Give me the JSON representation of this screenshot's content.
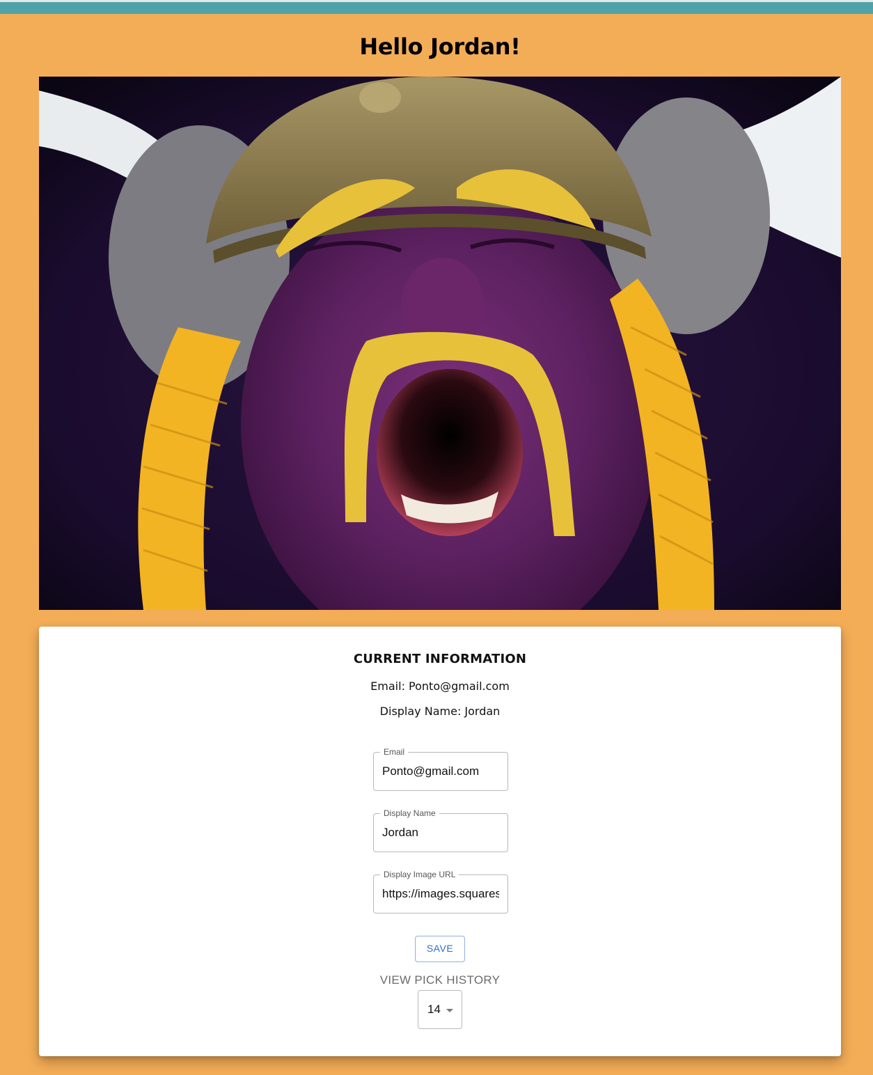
{
  "header": {
    "greeting": "Hello Jordan!"
  },
  "profile_image": {
    "description_icon": "profile-photo",
    "colors": {
      "face_paint_purple": "#5a1f5e",
      "face_paint_gold": "#e8c13a",
      "helmet": "#8c7a4e",
      "braids": "#f2b422"
    }
  },
  "current_info": {
    "title": "CURRENT INFORMATION",
    "email_line": "Email: Ponto@gmail.com",
    "display_name_line": "Display Name: Jordan"
  },
  "form": {
    "email": {
      "label": "Email",
      "value": "Ponto@gmail.com"
    },
    "display_name": {
      "label": "Display Name",
      "value": "Jordan"
    },
    "display_image_url": {
      "label": "Display Image URL",
      "value": "https://images.squarespace"
    },
    "save_label": "SAVE"
  },
  "pick_history": {
    "label": "VIEW PICK HISTORY",
    "selected_week": "14"
  },
  "colors": {
    "background": "#f4ad57",
    "top_bar": "#4fa3a8",
    "save_button_text": "#2f6fc4"
  }
}
